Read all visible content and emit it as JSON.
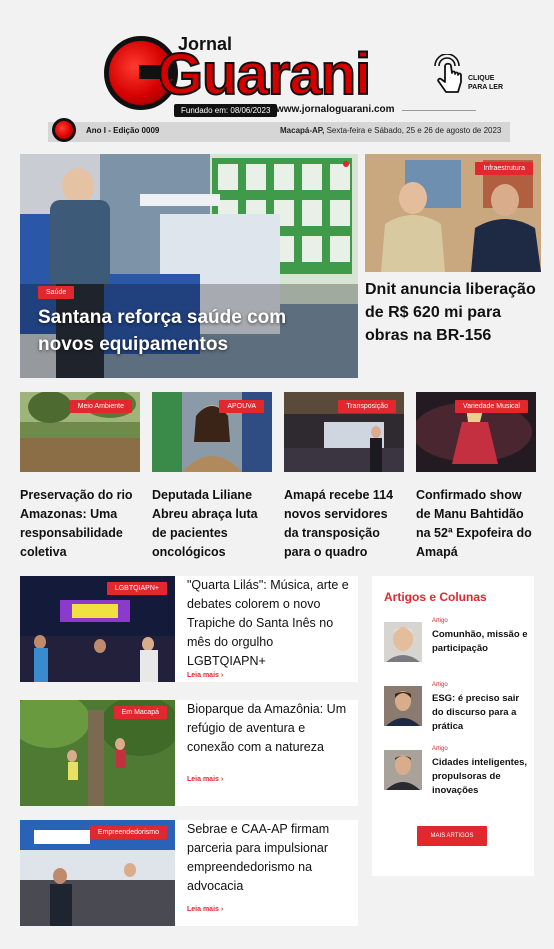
{
  "masthead": {
    "brand_prefix": "Jornal",
    "brand_name": "Guarani",
    "founded": "Fundado em: 08/06/2023",
    "website": "www.jornaloguarani.com",
    "click_to_read": "CLIQUE PARA LER",
    "edition": "Ano I - Edição 0009",
    "location": "Macapá-AP,",
    "date": "Sexta-feira e Sábado, 25 e 26 de agosto de 2023"
  },
  "featured": {
    "main": {
      "tag": "Saúde",
      "title": "Santana reforça saúde com novos equipamentos"
    },
    "side": {
      "tag": "Infraestrutura",
      "title": "Dnit anuncia liberação de R$ 620 mi para obras na BR-156"
    }
  },
  "grid": [
    {
      "tag": "Meio Ambiente",
      "title": "Preservação do rio Amazonas: Uma responsabilidade coletiva"
    },
    {
      "tag": "APOUVA",
      "title": "Deputada Liliane Abreu abraça luta de pacientes oncológicos"
    },
    {
      "tag": "Transposição",
      "title": "Amapá recebe 114 novos servidores da transposição para o quadro"
    },
    {
      "tag": "Variedade Musical",
      "title": "Confirmado show de Manu Bahtidão na 52ª Expofeira do Amapá"
    }
  ],
  "list": [
    {
      "tag": "LGBTQIAPN+",
      "title": "\"Quarta Lilás\": Música, arte e debates colorem o novo Trapiche do Santa Inês no mês do orgulho LGBTQIAPN+",
      "more": "Leia mais ›"
    },
    {
      "tag": "Em Macapá",
      "title": "Bioparque da Amazônia: Um refúgio de aventura e conexão com a natureza",
      "more": "Leia mais ›"
    },
    {
      "tag": "Empreendedorismo",
      "title": "Sebrae e CAA-AP firmam parceria para impulsionar empreendedorismo na advocacia",
      "more": "Leia mais ›"
    }
  ],
  "sidebar": {
    "heading": "Artigos e Colunas",
    "articles": [
      {
        "category": "Artigo",
        "title": "Comunhão, missão e participação"
      },
      {
        "category": "Artigo",
        "title": "ESG: é preciso sair do discurso para a prática"
      },
      {
        "category": "Artigo",
        "title": "Cidades inteligentes, propulsoras de inovações"
      }
    ],
    "more_button": "MAIS ARTIGOS"
  },
  "colors": {
    "accent": "#e0282e",
    "background": "#f2f2f2",
    "brand_red": "#d40000"
  }
}
